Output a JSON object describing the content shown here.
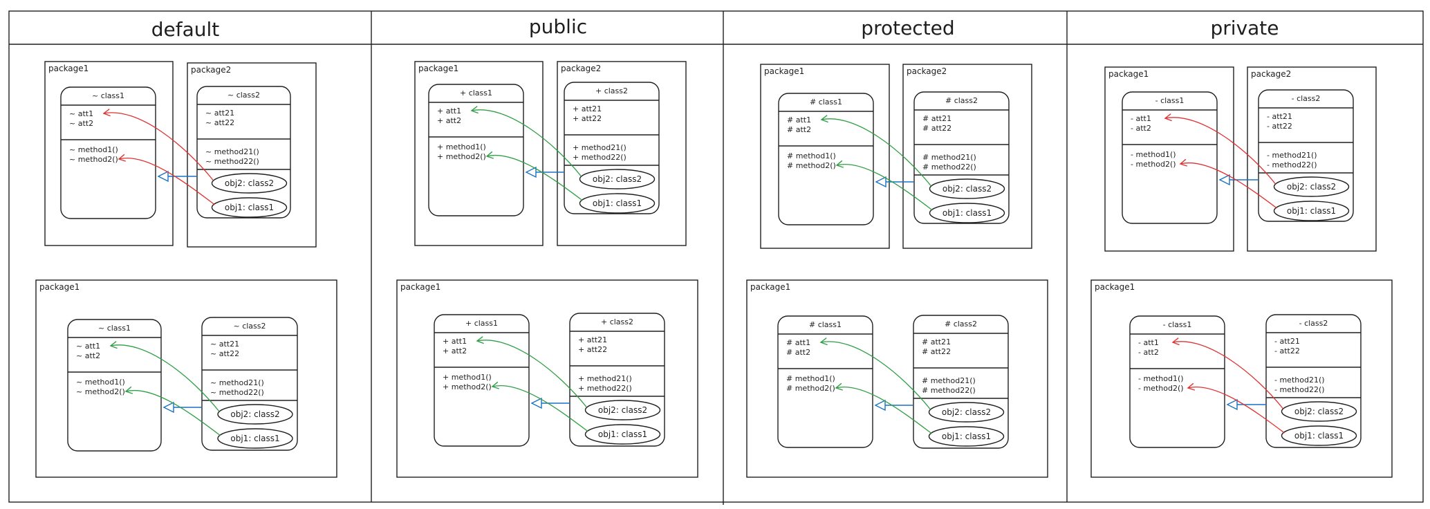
{
  "columns": [
    {
      "header": "default",
      "accent": "#e03131",
      "accent2": "#2f9e44",
      "diagrams": [
        {
          "package1": "package1",
          "package2": "package2",
          "class1": "~ class1",
          "class2": "~ class2",
          "att1": "~ att1",
          "att2": "~ att2",
          "method1": "~ method1()",
          "method2": "~ method2()",
          "att21": "~ att21",
          "att22": "~ att22",
          "method21": "~ method21()",
          "method22": "~ method22()",
          "obj2": "obj2: class2",
          "obj1": "obj1: class1",
          "arrow": "red"
        },
        {
          "package1": "package1",
          "class1": "~ class1",
          "class2": "~ class2",
          "att1": "~ att1",
          "att2": "~ att2",
          "method1": "~ method1()",
          "method2": "~ method2()",
          "att21": "~ att21",
          "att22": "~ att22",
          "method21": "~ method21()",
          "method22": "~ method22()",
          "obj2": "obj2: class2",
          "obj1": "obj1: class1",
          "arrow": "green"
        }
      ]
    },
    {
      "header": "public",
      "diagrams": [
        {
          "package1": "package1",
          "package2": "package2",
          "class1": "+ class1",
          "class2": "+ class2",
          "att1": "+ att1",
          "att2": "+ att2",
          "method1": "+ method1()",
          "method2": "+ method2()",
          "att21": "+ att21",
          "att22": "+ att22",
          "method21": "+ method21()",
          "method22": "+ method22()",
          "obj2": "obj2: class2",
          "obj1": "obj1: class1",
          "arrow": "green"
        },
        {
          "package1": "package1",
          "class1": "+ class1",
          "class2": "+ class2",
          "att1": "+ att1",
          "att2": "+ att2",
          "method1": "+ method1()",
          "method2": "+ method2()",
          "att21": "+ att21",
          "att22": "+ att22",
          "method21": "+ method21()",
          "method22": "+ method22()",
          "obj2": "obj2: class2",
          "obj1": "obj1: class1",
          "arrow": "green"
        }
      ]
    },
    {
      "header": "protected",
      "diagrams": [
        {
          "package1": "package1",
          "package2": "package2",
          "class1": "# class1",
          "class2": "# class2",
          "att1": "# att1",
          "att2": "# att2",
          "method1": "# method1()",
          "method2": "# method2()",
          "att21": "# att21",
          "att22": "# att22",
          "method21": "# method21()",
          "method22": "# method22()",
          "obj2": "obj2: class2",
          "obj1": "obj1: class1",
          "arrow": "green"
        },
        {
          "package1": "package1",
          "class1": "# class1",
          "class2": "# class2",
          "att1": "# att1",
          "att2": "# att2",
          "method1": "# method1()",
          "method2": "# method2()",
          "att21": "# att21",
          "att22": "# att22",
          "method21": "# method21()",
          "method22": "# method22()",
          "obj2": "obj2: class2",
          "obj1": "obj1: class1",
          "arrow": "green"
        }
      ]
    },
    {
      "header": "private",
      "diagrams": [
        {
          "package1": "package1",
          "package2": "package2",
          "class1": "- class1",
          "class2": "- class2",
          "att1": "- att1",
          "att2": "- att2",
          "method1": "- method1()",
          "method2": "- method2()",
          "att21": "- att21",
          "att22": "- att22",
          "method21": "- method21()",
          "method22": "- method22()",
          "obj2": "obj2: class2",
          "obj1": "obj1: class1",
          "arrow": "red"
        },
        {
          "package1": "package1",
          "class1": "- class1",
          "class2": "- class2",
          "att1": "- att1",
          "att2": "- att2",
          "method1": "- method1()",
          "method2": "- method2()",
          "att21": "- att21",
          "att22": "- att22",
          "method21": "- method21()",
          "method22": "- method22()",
          "obj2": "obj2: class2",
          "obj1": "obj1: class1",
          "arrow": "red"
        }
      ]
    }
  ],
  "colors": {
    "denied": "#e03131",
    "allowed": "#2f9e44",
    "inherit": "#1971c2",
    "line": "#1e1e1e"
  }
}
